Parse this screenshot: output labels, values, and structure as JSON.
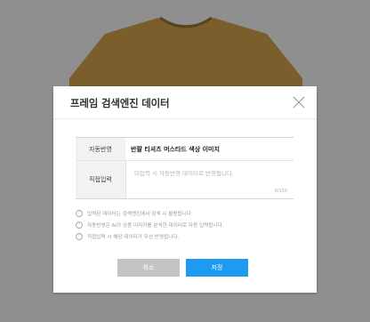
{
  "modal": {
    "title": "프레임 검색엔진 데이터",
    "close_icon": "close-icon"
  },
  "form": {
    "rows": [
      {
        "label": "자동반영",
        "value": "반팔 티셔츠 머스타드 색상 이미지"
      },
      {
        "label": "직접입력",
        "placeholder": "미입력 시 자동반영 데이터로 반영됩니다.",
        "char_count": "0/150"
      }
    ]
  },
  "notes": [
    "입력된 데이터는 검색엔진에서 검색 시 활용됩니다.",
    "자동반영은 AI가 상품 이미지를 분석한 데이터로 자동 입력됩니다.",
    "직접입력 시 해당 데이터가 우선 반영됩니다."
  ],
  "buttons": {
    "cancel": "취소",
    "save": "저장"
  },
  "colors": {
    "primary": "#1e9bf0",
    "cancel": "#c4c4c4",
    "tshirt": "#b5863b"
  }
}
